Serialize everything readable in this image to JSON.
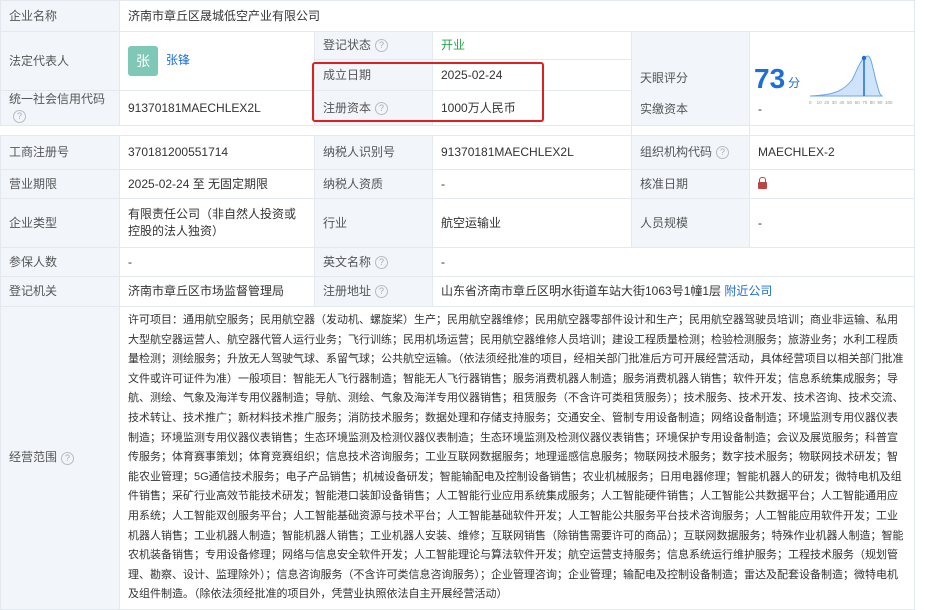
{
  "rows": {
    "company_name": {
      "label": "企业名称",
      "value": "济南市章丘区晟城低空产业有限公司"
    },
    "legal_rep": {
      "label": "法定代表人",
      "avatar_char": "张",
      "name": "张锋"
    },
    "reg_status": {
      "label": "登记状态",
      "value": "开业"
    },
    "tianyan_score": {
      "label": "天眼评分",
      "score": "73",
      "unit": "分"
    },
    "found_date": {
      "label": "成立日期",
      "value": "2025-02-24"
    },
    "reg_capital": {
      "label": "注册资本",
      "value": "1000万人民币"
    },
    "credit_code": {
      "label": "统一社会信用代码",
      "value": "91370181MAECHLEX2L"
    },
    "paid_capital": {
      "label": "实缴资本",
      "value": "-"
    },
    "biz_reg_no": {
      "label": "工商注册号",
      "value": "370181200551714"
    },
    "taxpayer_id": {
      "label": "纳税人识别号",
      "value": "91370181MAECHLEX2L"
    },
    "org_code": {
      "label": "组织机构代码",
      "value": "MAECHLEX-2"
    },
    "biz_term": {
      "label": "营业期限",
      "value": "2025-02-24 至 无固定期限"
    },
    "taxpayer_qual": {
      "label": "纳税人资质",
      "value": "-"
    },
    "approval_date": {
      "label": "核准日期"
    },
    "company_type": {
      "label": "企业类型",
      "value": "有限责任公司（非自然人投资或控股的法人独资）"
    },
    "industry": {
      "label": "行业",
      "value": "航空运输业"
    },
    "staff_size": {
      "label": "人员规模",
      "value": "-"
    },
    "insured": {
      "label": "参保人数",
      "value": "-"
    },
    "english_name": {
      "label": "英文名称",
      "value": "-"
    },
    "reg_authority": {
      "label": "登记机关",
      "value": "济南市章丘区市场监督管理局"
    },
    "reg_address": {
      "label": "注册地址",
      "value": "山东省济南市章丘区明水街道车站大街1063号1幢1层",
      "link": "附近公司"
    },
    "scope": {
      "label": "经营范围",
      "value": "许可项目：通用航空服务；民用航空器（发动机、螺旋桨）生产；民用航空器维修；民用航空器零部件设计和生产；民用航空器驾驶员培训；商业非运输、私用大型航空器运营人、航空器代管人运行业务；飞行训练；民用机场运营；民用航空器维修人员培训；建设工程质量检测；检验检测服务；旅游业务；水利工程质量检测；测绘服务；升放无人驾驶气球、系留气球；公共航空运输。（依法须经批准的项目，经相关部门批准后方可开展经营活动，具体经营项目以相关部门批准文件或许可证件为准）一般项目：智能无人飞行器制造；智能无人飞行器销售；服务消费机器人制造；服务消费机器人销售；软件开发；信息系统集成服务；导航、测绘、气象及海洋专用仪器制造；导航、测绘、气象及海洋专用仪器销售；租赁服务（不含许可类租赁服务）；技术服务、技术开发、技术咨询、技术交流、技术转让、技术推广；新材料技术推广服务；消防技术服务；数据处理和存储支持服务；交通安全、管制专用设备制造；网络设备制造；环境监测专用仪器仪表制造；环境监测专用仪器仪表销售；生态环境监测及检测仪器仪表制造；生态环境监测及检测仪器仪表销售；环境保护专用设备制造；会议及展览服务；科普宣传服务；体育赛事策划；体育竞赛组织；信息技术咨询服务；工业互联网数据服务；地理遥感信息服务；物联网技术服务；数字技术服务；物联网技术研发；智能农业管理；5G通信技术服务；电子产品销售；机械设备研发；智能输配电及控制设备销售；农业机械服务；日用电器修理；智能机器人的研发；微特电机及组件销售；采矿行业高效节能技术研发；智能港口装卸设备销售；人工智能行业应用系统集成服务；人工智能硬件销售；人工智能公共数据平台；人工智能通用应用系统；人工智能双创服务平台；人工智能基础资源与技术平台；人工智能基础软件开发；人工智能公共服务平台技术咨询服务；人工智能应用软件开发；工业机器人销售；工业机器人制造；智能机器人销售；工业机器人安装、维修；互联网销售（除销售需要许可的商品）；互联网数据服务；特殊作业机器人制造；智能农机装备销售；专用设备修理；网络与信息安全软件开发；人工智能理论与算法软件开发；航空运营支持服务；信息系统运行维护服务；工程技术服务（规划管理、勘察、设计、监理除外）；信息咨询服务（不含许可类信息咨询服务）；企业管理咨询；企业管理；输配电及控制设备制造；雷达及配套设备制造；微特电机及组件制造。（除依法须经批准的项目外，凭营业执照依法自主开展经营活动）"
    }
  },
  "score_chart": {
    "x_ticks": [
      "0",
      "10",
      "20",
      "30",
      "40",
      "50",
      "60",
      "70",
      "80",
      "90",
      "100"
    ],
    "colors": {
      "curve_fill": "#cfe3fa",
      "curve_line": "#6aa7ea",
      "highlight": "#1b6fd6"
    }
  },
  "colors": {
    "label_bg": "#f2f6fb",
    "border": "#e4e8ef",
    "highlight_box": "#e02020",
    "link": "#1b6fd6",
    "status": "#2aa64a"
  }
}
